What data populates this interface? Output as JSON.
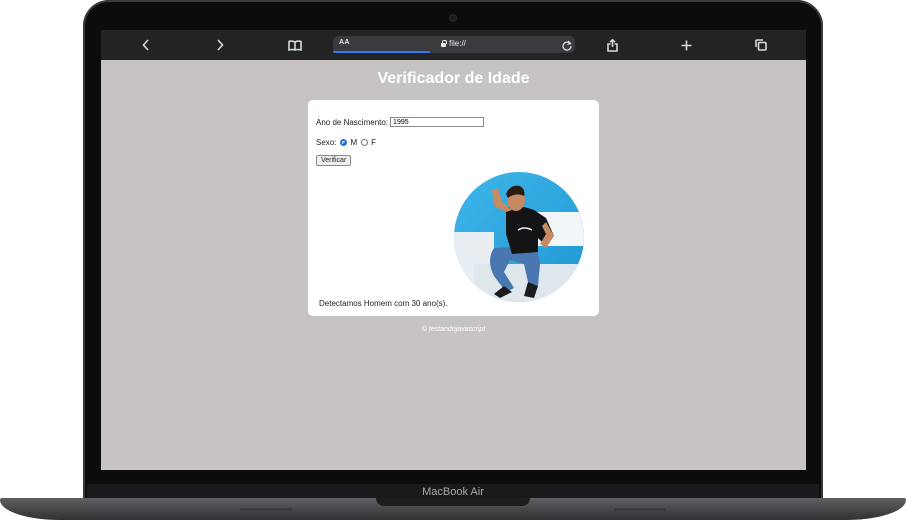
{
  "device": {
    "label": "MacBook Air"
  },
  "browser": {
    "reader_label": "AA",
    "url": "file://",
    "load_progress": 0.4,
    "icons": [
      "chevron-left-icon",
      "chevron-right-icon",
      "bookmarks-icon",
      "reload-icon",
      "share-icon",
      "plus-icon",
      "tabs-icon"
    ]
  },
  "page": {
    "title": "Verificador de Idade",
    "form": {
      "birth_year_label": "Ano de Nascimento:",
      "birth_year_value": "1995",
      "sex_label": "Sexo:",
      "option_m": "M",
      "option_f": "F",
      "selected": "M",
      "verify_button": "Verificar"
    },
    "result_text": "Detectamos Homem com 30 ano(s).",
    "footer": "© testandojavascript"
  },
  "colors": {
    "page_bg": "#c8c3c3",
    "toolbar_bg": "#222325",
    "accent": "#1f6ee0",
    "photo_bg": "#2aa9e0"
  }
}
